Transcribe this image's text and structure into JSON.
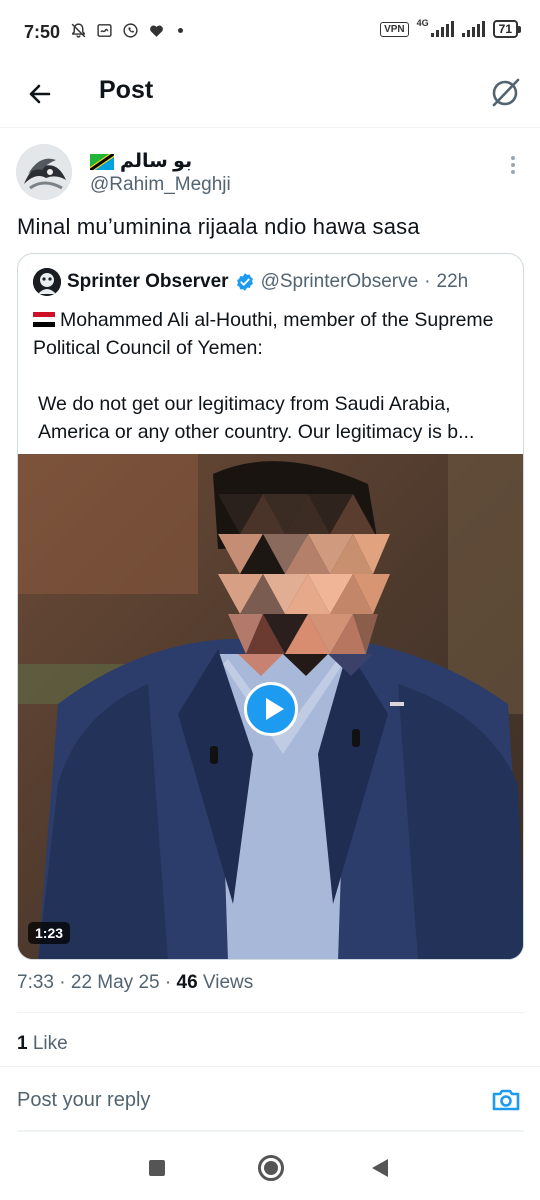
{
  "status_bar": {
    "time": "7:50",
    "vpn": "VPN",
    "network": "4G",
    "battery": "71"
  },
  "header": {
    "title": "Post",
    "back_icon": "arrow-left-icon",
    "grok_icon": "grok-icon"
  },
  "post": {
    "author_name": "بو سالم",
    "author_flag": "tanzania-flag-icon",
    "author_handle": "@Rahim_Meghji",
    "text": "Minal mu’uminina rijaala ndio hawa sasa",
    "time": "7:33",
    "date": "22 May 25",
    "views_count": "46",
    "views_label": "Views",
    "likes_count": "1",
    "likes_label": "Like"
  },
  "quote": {
    "name": "Sprinter Observer",
    "handle": "@SprinterObserve",
    "age": "22h",
    "line1": "Mohammed Ali al-Houthi, member of the Supreme Political Council of Yemen:",
    "line2": "We do not get our legitimacy from Saudi Arabia, America or any other country. Our legitimacy is b...",
    "video_duration": "1:23"
  },
  "reply": {
    "placeholder": "Post your reply",
    "camera_icon": "camera-icon"
  },
  "colors": {
    "accent": "#1d9bf0",
    "text": "#0f1419",
    "secondary": "#536471"
  }
}
